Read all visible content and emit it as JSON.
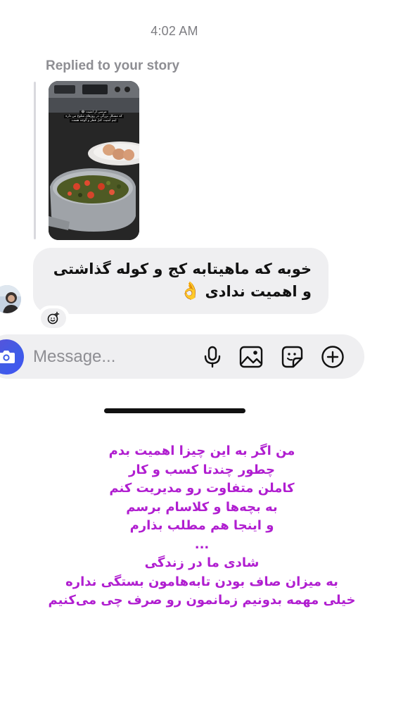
{
  "header": {
    "timestamp": "4:02 AM"
  },
  "story_reply": {
    "label": "Replied to your story",
    "story_overlay_text": [
      "مرسی از امنیت 😂",
      "که مشکل بزرگی در روزهای شلوغ من داره",
      "اینم امنیت کنل قطر و گوجه هست"
    ]
  },
  "message": {
    "lines": [
      "خوبه که ماهیتابه کج و کوله گذاشتی",
      "و اهمیت ندادی"
    ],
    "emoji": "👌"
  },
  "composer": {
    "placeholder": "Message...",
    "icons": [
      "camera-icon",
      "microphone-icon",
      "gallery-icon",
      "sticker-icon",
      "plus-icon"
    ]
  },
  "caption": {
    "color": "#b01ed0",
    "lines": [
      "من اگر به این چیزا اهمیت بدم",
      "چطور چندتا کسب و کار",
      "کاملن متفاوت رو مدیریت کنم",
      "به بچه‌ها و کلاسام برسم",
      "و اینجا هم مطلب بذارم",
      "...",
      "شادی ما در زندگی",
      "به میزان صاف بودن تابه‌هامون بستگی نداره",
      "خیلی مهمه بدونیم زمانمون رو صرف چی می‌کنیم"
    ]
  },
  "colors": {
    "bubble": "#efeff1",
    "accent_camera": "#405de6",
    "caption_text": "#b01ed0"
  }
}
